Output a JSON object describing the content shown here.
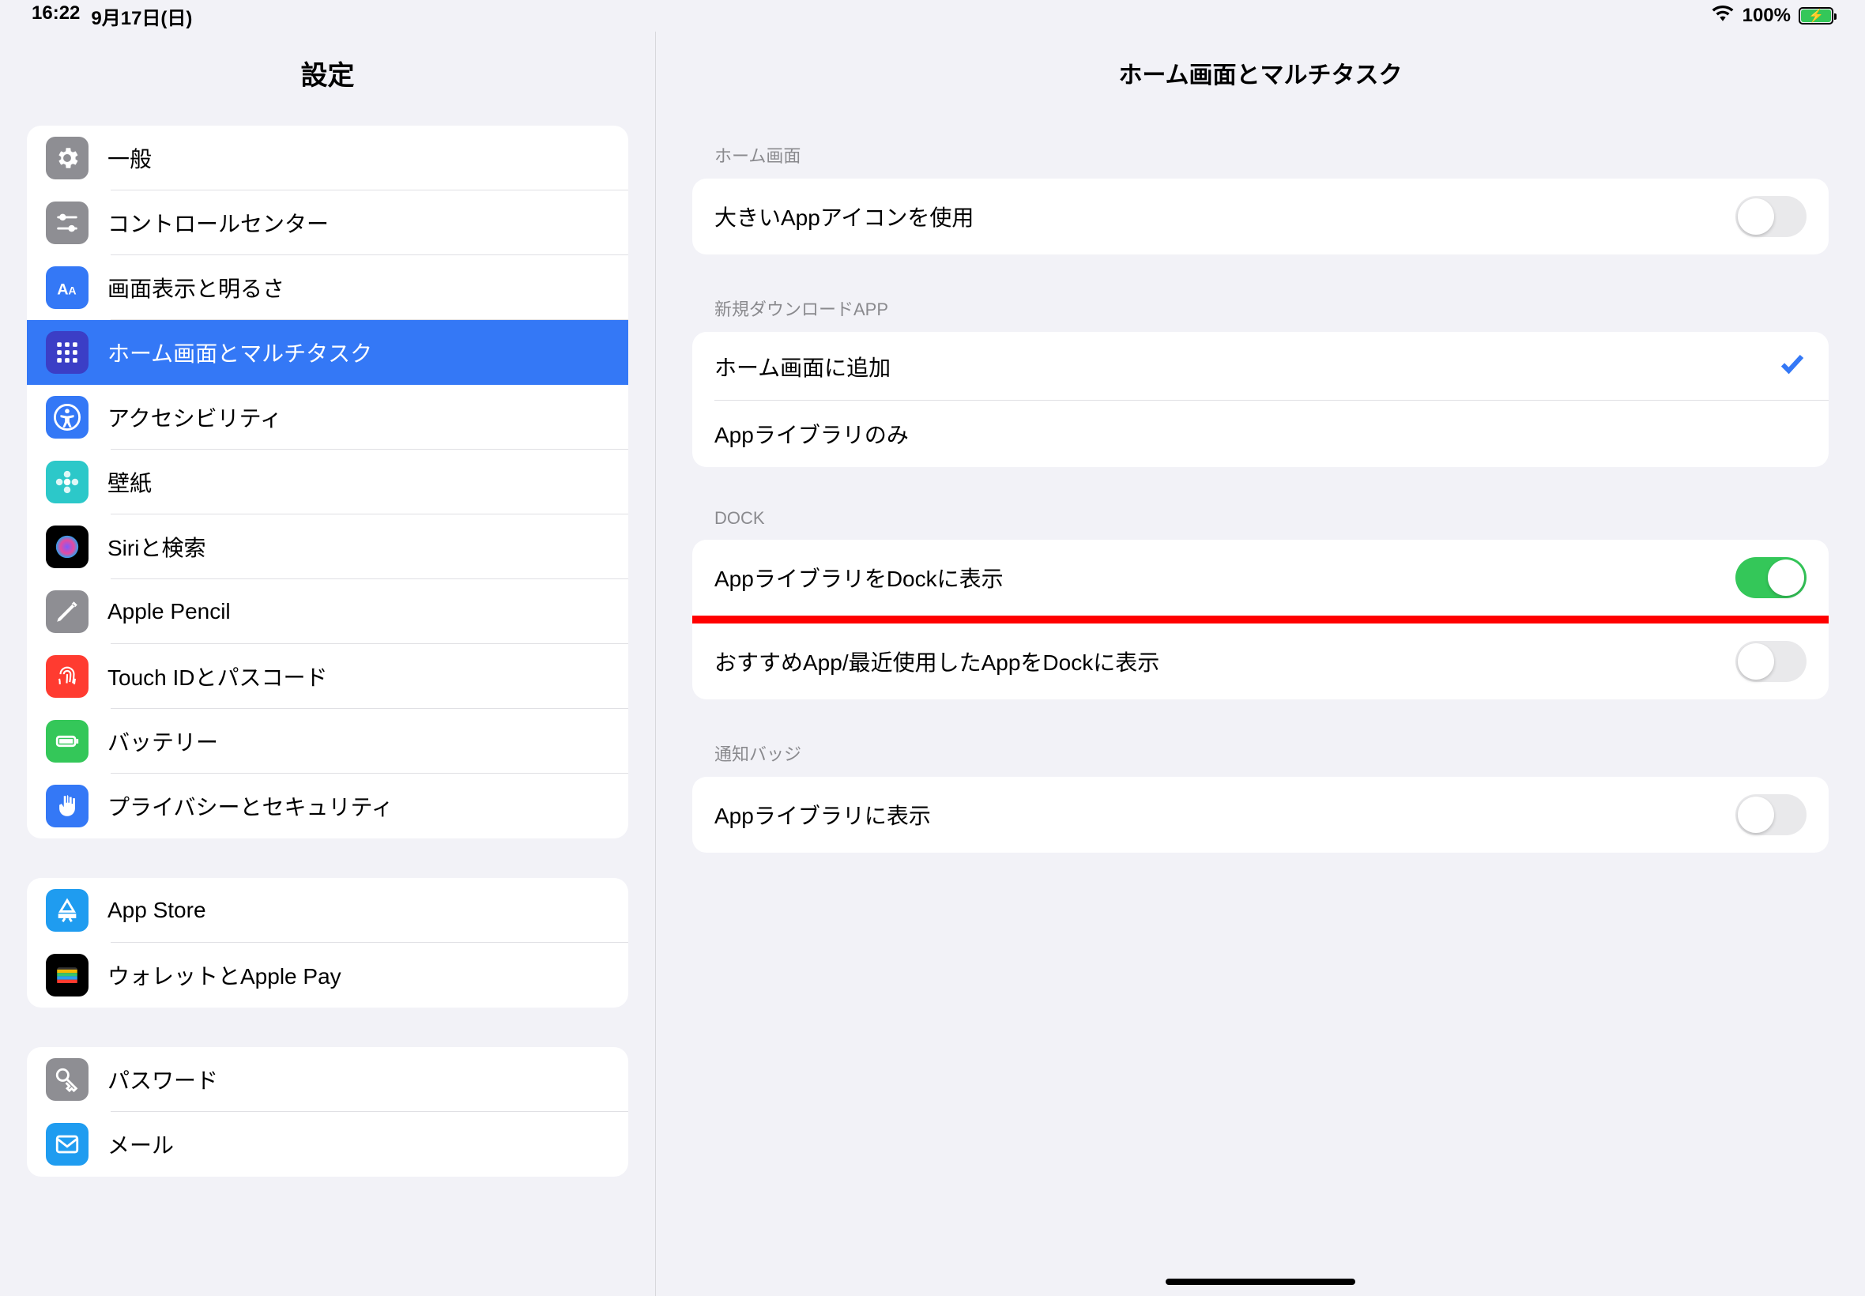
{
  "status": {
    "time": "16:22",
    "date": "9月17日(日)",
    "battery_pct": "100%"
  },
  "sidebar": {
    "title": "設定",
    "groups": [
      {
        "items": [
          {
            "id": "general",
            "label": "一般",
            "icon": "gear",
            "bg": "#8e8e93"
          },
          {
            "id": "control-center",
            "label": "コントロールセンター",
            "icon": "sliders",
            "bg": "#8e8e93"
          },
          {
            "id": "display",
            "label": "画面表示と明るさ",
            "icon": "aa",
            "bg": "#3478f6"
          },
          {
            "id": "home-screen",
            "label": "ホーム画面とマルチタスク",
            "icon": "grid",
            "bg": "#3b3ec6",
            "selected": true
          },
          {
            "id": "accessibility",
            "label": "アクセシビリティ",
            "icon": "access",
            "bg": "#3478f6"
          },
          {
            "id": "wallpaper",
            "label": "壁紙",
            "icon": "flower",
            "bg": "#2cc8c9"
          },
          {
            "id": "siri",
            "label": "Siriと検索",
            "icon": "siri",
            "bg": "#000000"
          },
          {
            "id": "apple-pencil",
            "label": "Apple Pencil",
            "icon": "pencil",
            "bg": "#8e8e93"
          },
          {
            "id": "touch-id",
            "label": "Touch IDとパスコード",
            "icon": "fingerprint",
            "bg": "#ff3b30"
          },
          {
            "id": "battery",
            "label": "バッテリー",
            "icon": "battery",
            "bg": "#34c759"
          },
          {
            "id": "privacy",
            "label": "プライバシーとセキュリティ",
            "icon": "hand",
            "bg": "#3478f6"
          }
        ]
      },
      {
        "items": [
          {
            "id": "app-store",
            "label": "App Store",
            "icon": "appstore",
            "bg": "#1f9cf0"
          },
          {
            "id": "wallet",
            "label": "ウォレットとApple Pay",
            "icon": "wallet",
            "bg": "#000000"
          }
        ]
      },
      {
        "items": [
          {
            "id": "passwords",
            "label": "パスワード",
            "icon": "key",
            "bg": "#8e8e93"
          },
          {
            "id": "mail",
            "label": "メール",
            "icon": "mail",
            "bg": "#1f9cf0"
          }
        ]
      }
    ]
  },
  "detail": {
    "title": "ホーム画面とマルチタスク",
    "sections": [
      {
        "header": "ホーム画面",
        "rows": [
          {
            "label": "大きいAppアイコンを使用",
            "control": "switch",
            "on": false
          }
        ]
      },
      {
        "header": "新規ダウンロードAPP",
        "rows": [
          {
            "label": "ホーム画面に追加",
            "control": "check",
            "checked": true
          },
          {
            "label": "Appライブラリのみ",
            "control": "none"
          }
        ]
      },
      {
        "header": "DOCK",
        "rows": [
          {
            "label": "AppライブラリをDockに表示",
            "control": "switch",
            "on": true,
            "highlight": true
          },
          {
            "label": "おすすめApp/最近使用したAppをDockに表示",
            "control": "switch",
            "on": false
          }
        ]
      },
      {
        "header": "通知バッジ",
        "rows": [
          {
            "label": "Appライブラリに表示",
            "control": "switch",
            "on": false
          }
        ]
      }
    ]
  }
}
